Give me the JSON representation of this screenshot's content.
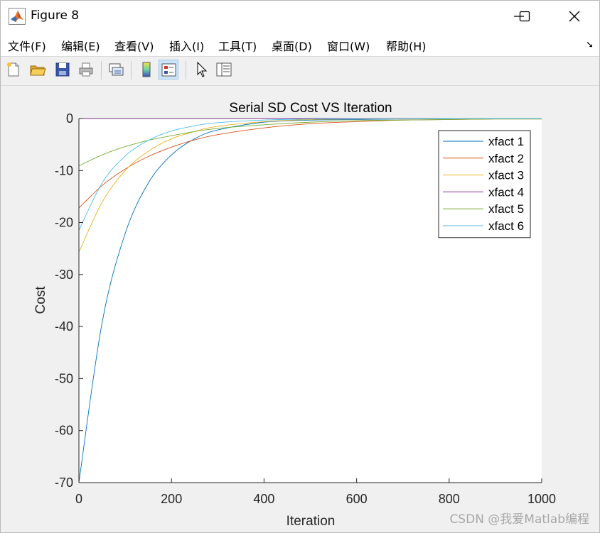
{
  "window": {
    "title": "Figure 8"
  },
  "menu": [
    {
      "id": "file",
      "label": "文件(F)"
    },
    {
      "id": "edit",
      "label": "编辑(E)"
    },
    {
      "id": "view",
      "label": "查看(V)"
    },
    {
      "id": "insert",
      "label": "插入(I)"
    },
    {
      "id": "tools",
      "label": "工具(T)"
    },
    {
      "id": "desktop",
      "label": "桌面(D)"
    },
    {
      "id": "window",
      "label": "窗口(W)"
    },
    {
      "id": "help",
      "label": "帮助(H)"
    }
  ],
  "toolbar": {
    "buttons": [
      {
        "id": "new-figure",
        "icon": "new-file-icon"
      },
      {
        "id": "open-file",
        "icon": "open-folder-icon"
      },
      {
        "id": "save",
        "icon": "save-icon"
      },
      {
        "id": "print",
        "icon": "print-icon"
      },
      {
        "id": "link-plot",
        "icon": "link-plot-icon"
      },
      {
        "id": "insert-colorbar",
        "icon": "colorbar-icon"
      },
      {
        "id": "insert-legend",
        "icon": "legend-icon",
        "active": true
      },
      {
        "id": "edit-plot",
        "icon": "pointer-icon"
      },
      {
        "id": "property-inspector",
        "icon": "panel-icon"
      }
    ]
  },
  "colors": {
    "xfact1": "#0072bd",
    "xfact2": "#d95319",
    "xfact3": "#edb120",
    "xfact4": "#7e2f8e",
    "xfact5": "#77ac30",
    "xfact6": "#4dbeee"
  },
  "chart_data": {
    "type": "line",
    "title": "Serial SD Cost VS Iteration",
    "xlabel": "Iteration",
    "ylabel": "Cost",
    "xlim": [
      0,
      1000
    ],
    "ylim": [
      -70,
      0
    ],
    "xticks": [
      0,
      200,
      400,
      600,
      800,
      1000
    ],
    "yticks": [
      0,
      -10,
      -20,
      -30,
      -40,
      -50,
      -60,
      -70
    ],
    "grid": false,
    "legend_position": "top-right",
    "x": [
      0,
      50,
      100,
      150,
      200,
      250,
      300,
      400,
      500,
      600,
      700,
      800,
      900,
      1000
    ],
    "series": [
      {
        "name": "xfact 1",
        "color": "#0072bd",
        "values": [
          -70,
          -39.3,
          -22.1,
          -12.4,
          -7.0,
          -3.9,
          -2.2,
          -0.7,
          -0.3,
          -0.2,
          -0.1,
          -0.05,
          -0.02,
          0
        ]
      },
      {
        "name": "xfact 2",
        "color": "#d95319",
        "values": [
          -17.2,
          -12.9,
          -9.7,
          -7.3,
          -5.5,
          -4.1,
          -3.1,
          -1.8,
          -1.0,
          -0.6,
          -0.3,
          -0.2,
          -0.1,
          -0.1
        ]
      },
      {
        "name": "xfact 3",
        "color": "#edb120",
        "values": [
          -25.7,
          -16.1,
          -10.0,
          -6.3,
          -3.9,
          -2.5,
          -1.5,
          -0.6,
          -0.2,
          -0.1,
          -0.05,
          -0.02,
          0,
          0
        ]
      },
      {
        "name": "xfact 4",
        "color": "#7e2f8e",
        "values": [
          0,
          0,
          0,
          0,
          0,
          0,
          0,
          0,
          0,
          0,
          0,
          0,
          0,
          0
        ]
      },
      {
        "name": "xfact 5",
        "color": "#77ac30",
        "values": [
          -9.1,
          -7.0,
          -5.4,
          -4.2,
          -3.3,
          -2.5,
          -1.9,
          -1.2,
          -0.7,
          -0.4,
          -0.3,
          -0.2,
          -0.1,
          -0.1
        ]
      },
      {
        "name": "xfact 6",
        "color": "#4dbeee",
        "values": [
          -21.5,
          -12.4,
          -7.2,
          -4.2,
          -2.4,
          -1.4,
          -0.8,
          -0.3,
          -0.1,
          -0.05,
          -0.02,
          0,
          0,
          0
        ]
      }
    ]
  },
  "watermark": "CSDN @我爱Matlab编程"
}
